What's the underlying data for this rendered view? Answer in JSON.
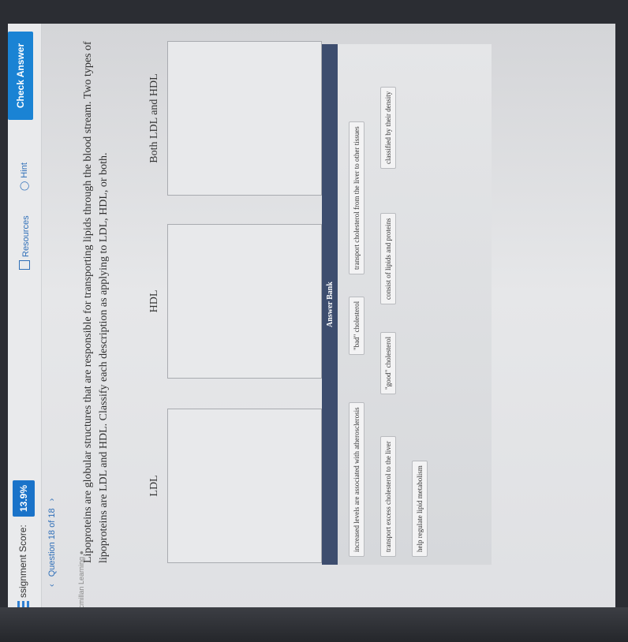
{
  "header": {
    "score_label": "ssignment Score:",
    "score_value": "13.9%",
    "resources_label": "Resources",
    "hint_label": "Hint",
    "check_answer_label": "Check Answer"
  },
  "navigation": {
    "question_counter": "Question 18 of 18",
    "brand": "Macmillan Learning"
  },
  "question": {
    "line1": "Lipoproteins are globular structures that are responsible for transporting lipids through the blood stream. Two types of",
    "line2": "lipoproteins are LDL and HDL. Classify each description as applying to LDL, HDL, or both."
  },
  "columns": [
    "LDL",
    "HDL",
    "Both LDL and HDL"
  ],
  "answer_bank": {
    "title": "Answer Bank",
    "items": [
      "increased levels are associated with atherosclerosis",
      "\"bad\" cholesterol",
      "transport cholesterol from the liver to other tissues",
      "transport excess cholesterol to the liver",
      "\"good\" cholesterol",
      "consist of lipids and proteins",
      "classified by their density",
      "help regulate lipid metabolism"
    ]
  }
}
